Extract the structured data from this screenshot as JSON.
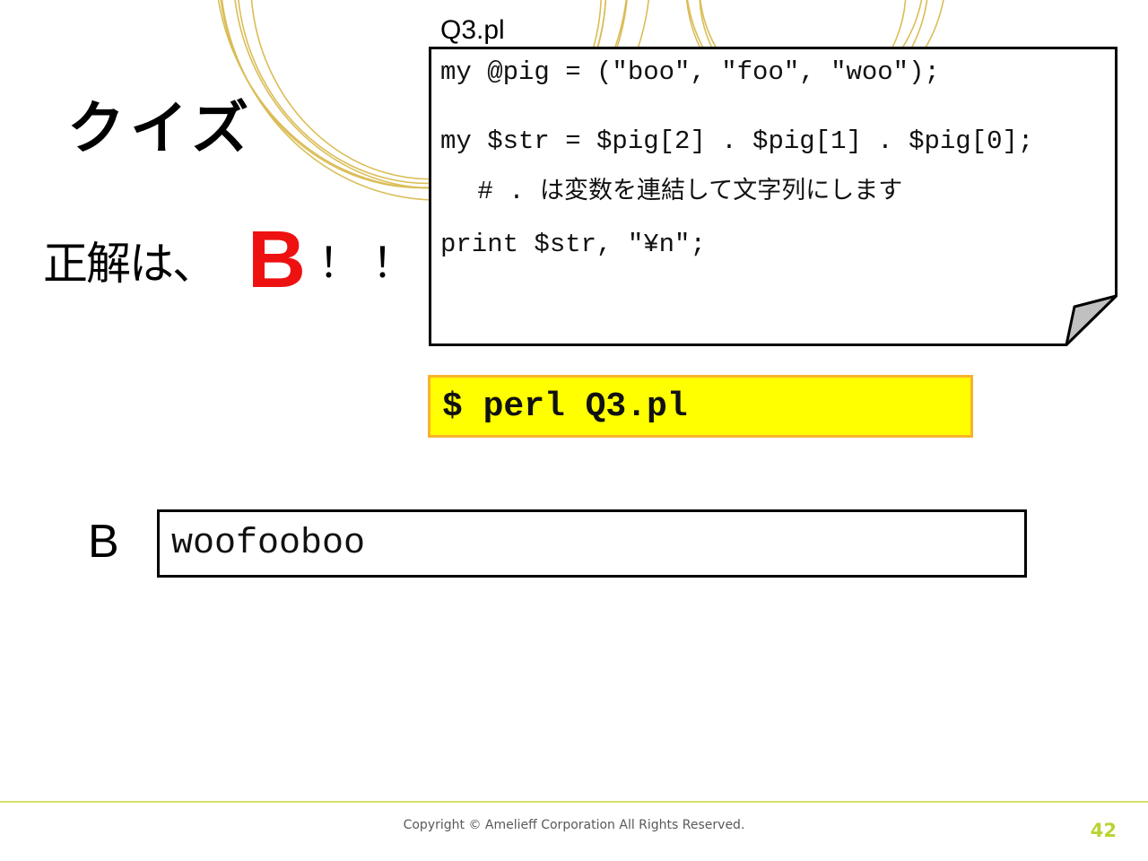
{
  "slide": {
    "title": "クイズ",
    "answer": {
      "prefix": "正解は、",
      "letter": "B",
      "suffix": "！！"
    },
    "code_file": {
      "filename": "Q3.pl",
      "lines": [
        "my @pig = (\"boo\", \"foo\", \"woo\");",
        "my $str = $pig[2] . $pig[1] . $pig[0];",
        "print $str, \"¥n\";"
      ],
      "comment_code": " # . ",
      "comment_text": "は変数を連結して文字列にします"
    },
    "command": "$ perl Q3.pl",
    "option": {
      "label": "B",
      "value": "woofooboo"
    }
  },
  "footer": {
    "copyright": "Copyright © Amelieff Corporation All Rights Reserved.",
    "page_number": "42"
  },
  "colors": {
    "answer_red": "#ee1111",
    "command_fill": "#ffff00",
    "command_border": "#f7b32e",
    "accent_lime": "#b8d434",
    "decor_gold": "#d4b23a"
  }
}
